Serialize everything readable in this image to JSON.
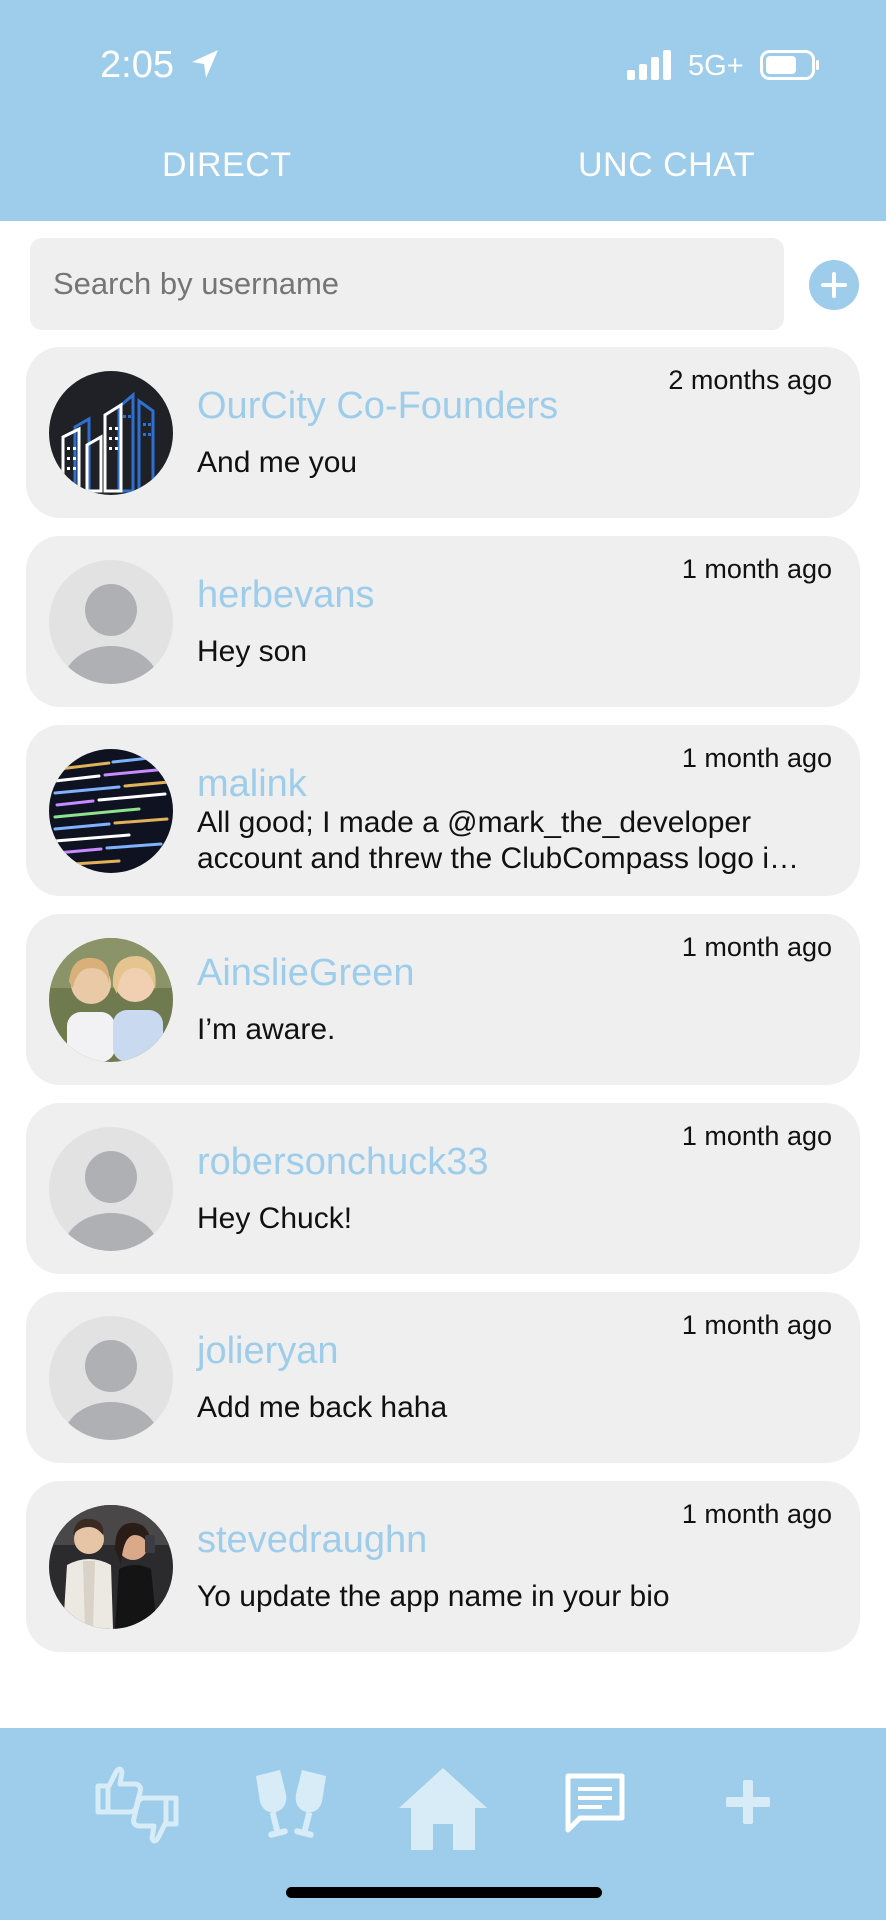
{
  "status": {
    "time": "2:05",
    "network": "5G+"
  },
  "tabs": [
    {
      "label": "DIRECT"
    },
    {
      "label": "UNC CHAT"
    }
  ],
  "search": {
    "placeholder": "Search by username"
  },
  "conversations": [
    {
      "name": "OurCity Co-Founders",
      "message": "And me you",
      "time": "2 months ago",
      "avatar": "city-logo"
    },
    {
      "name": "herbevans",
      "message": "Hey son",
      "time": "1 month ago",
      "avatar": "default-person"
    },
    {
      "name": "malink",
      "message_line1": "All good; I made a @mark_the_developer",
      "message_line2": "account and threw the ClubCompass logo i…",
      "time": "1 month ago",
      "avatar": "code-photo"
    },
    {
      "name": "AinslieGreen",
      "message": "I’m aware.",
      "time": "1 month ago",
      "avatar": "photo"
    },
    {
      "name": "robersonchuck33",
      "message": "Hey Chuck!",
      "time": "1 month ago",
      "avatar": "default-person"
    },
    {
      "name": "jolieryan",
      "message": "Add me back haha",
      "time": "1 month ago",
      "avatar": "default-person"
    },
    {
      "name": "stevedraughn",
      "message": "Yo update the app name in your bio",
      "time": "1 month ago",
      "avatar": "photo"
    }
  ],
  "nav": [
    "thumbs-up-down-icon",
    "cheers-icon",
    "home-icon",
    "chat-icon",
    "plus-icon"
  ],
  "colors": {
    "accent": "#9dcdea",
    "row_bg": "#efefef"
  }
}
